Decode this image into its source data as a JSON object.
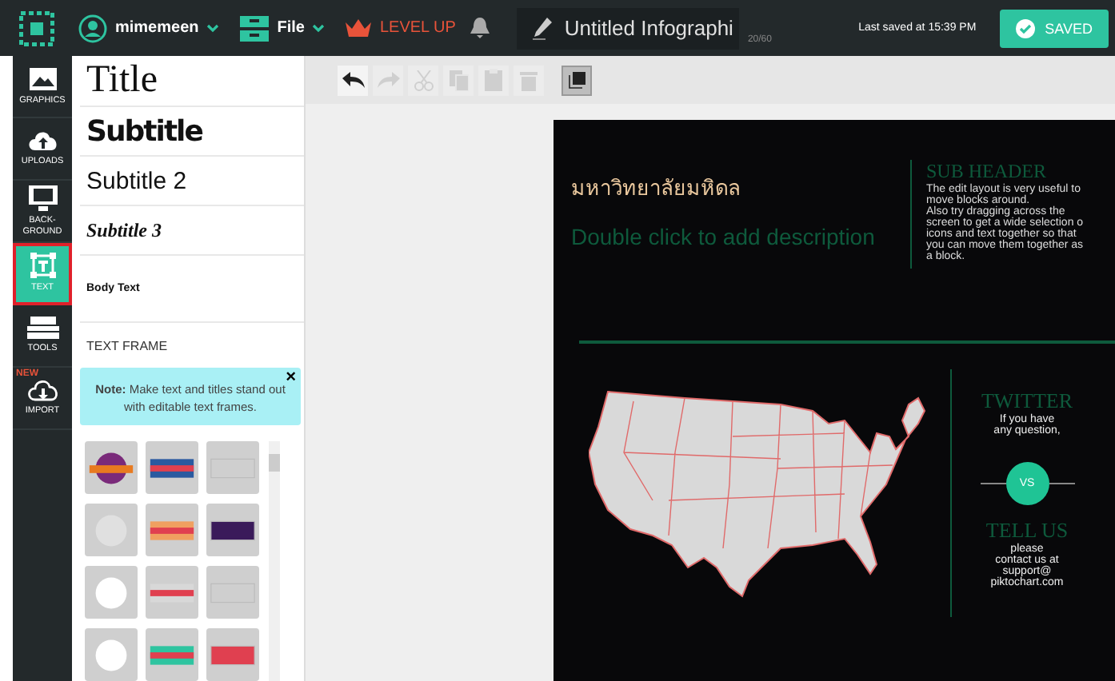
{
  "topbar": {
    "username": "mimemeen",
    "file_menu": "File",
    "level_up": "LEVEL UP",
    "doc_title": "Untitled Infographi",
    "char_count": "20/60",
    "last_saved": "Last saved at 15:39 PM",
    "save_button": "SAVED"
  },
  "rail": [
    {
      "label": "GRAPHICS",
      "kind": "image",
      "selected": false
    },
    {
      "label": "UPLOADS",
      "kind": "upload",
      "selected": false
    },
    {
      "label": "BACK-\nGROUND",
      "kind": "monitor",
      "selected": false
    },
    {
      "label": "TEXT",
      "kind": "text",
      "selected": true
    },
    {
      "label": "TOOLS",
      "kind": "toolbox",
      "selected": false
    },
    {
      "label": "IMPORT",
      "kind": "import",
      "selected": false,
      "badge": "NEW"
    }
  ],
  "text_styles": [
    {
      "label": "Title",
      "kind": "title"
    },
    {
      "label": "Subtitle",
      "kind": "subtitle"
    },
    {
      "label": "Subtitle 2",
      "kind": "subtitle2"
    },
    {
      "label": "Subtitle 3",
      "kind": "subtitle3"
    },
    {
      "label": "Body Text",
      "kind": "body"
    }
  ],
  "text_frame": {
    "heading": "TEXT FRAME",
    "note": "**Note:** Make text and titles stand out with editable text frames.",
    "close": "×"
  },
  "toolbar": [
    {
      "kind": "undo",
      "disabled": false
    },
    {
      "kind": "redo",
      "disabled": true
    },
    {
      "kind": "cut",
      "disabled": true
    },
    {
      "kind": "copy",
      "disabled": true
    },
    {
      "kind": "paste",
      "disabled": true
    },
    {
      "kind": "delete",
      "disabled": true
    },
    {
      "kind": "layer",
      "disabled": false
    }
  ],
  "canvas": {
    "title": "มหาวิทยาลัยมหิดล",
    "description": "Double click to add description",
    "sub_header": "SUB HEADER",
    "sub_text": "The edit layout is very useful to\nmove blocks around.\nAlso try dragging across the\nscreen to get a wide selection o\nicons and text together so that\nyou can move them together as\na block.",
    "twitter": "TWITTER",
    "twitter_text": "If you have\nany question,",
    "vs": "VS",
    "tell_us": "TELL US",
    "tell_text": "please\ncontact us at\nsupport@\npiktochart.com"
  }
}
